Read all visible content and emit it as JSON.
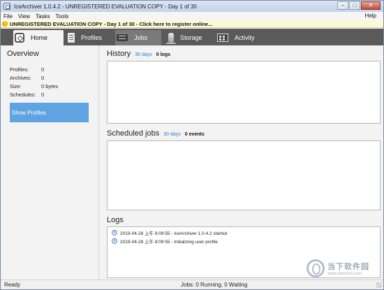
{
  "window": {
    "title": "IceArchiver 1.0.4.2 - UNREGISTERED EVALUATION COPY - Day 1 of 30",
    "controls": {
      "minimize": "–",
      "maximize": "□",
      "close": "✕"
    }
  },
  "menu": {
    "items": [
      "File",
      "View",
      "Tasks",
      "Tools"
    ],
    "help": "Help"
  },
  "banner": {
    "text": "UNREGISTERED EVALUATION COPY - Day 1 of 30 - Click here to register online...",
    "icon": "warning-icon"
  },
  "nav": {
    "tabs": [
      {
        "label": "Home",
        "icon": "home-icon",
        "active": true
      },
      {
        "label": "Profiles",
        "icon": "profiles-icon",
        "active": false
      },
      {
        "label": "Jobs",
        "icon": "jobs-icon",
        "active": false
      },
      {
        "label": "Storage",
        "icon": "storage-icon",
        "active": false
      },
      {
        "label": "Activity",
        "icon": "activity-icon",
        "active": false
      }
    ]
  },
  "overview": {
    "title": "Overview",
    "stats": [
      {
        "label": "Profiles:",
        "value": "0"
      },
      {
        "label": "Archives:",
        "value": "0"
      },
      {
        "label": "Size:",
        "value": "0 bytes"
      },
      {
        "label": "Schedules:",
        "value": "0"
      }
    ],
    "show_profiles_label": "Show Profiles"
  },
  "history": {
    "title": "History",
    "range": "30 days",
    "count": "0 logs"
  },
  "scheduled": {
    "title": "Scheduled jobs",
    "range": "30 days",
    "count": "0 events"
  },
  "logs": {
    "title": "Logs",
    "entries": [
      {
        "text": "2019-04-28 上午 8:09:55 - IceArchiver 1.0.4.2 started",
        "icon": "info-icon"
      },
      {
        "text": "2019-04-28 上午 8:09:55 - Initializing user profile",
        "icon": "info-icon"
      }
    ]
  },
  "status": {
    "left": "Ready",
    "center": "Jobs: 0 Running, 0 Waiting"
  },
  "watermark": {
    "cn": "当下软件园",
    "url": "www.downxia.com"
  },
  "colors": {
    "accent": "#5fa3e1",
    "nav_bg": "#5a5a5a",
    "link": "#2f7ac4",
    "banner_bg": "#fbfad7"
  }
}
